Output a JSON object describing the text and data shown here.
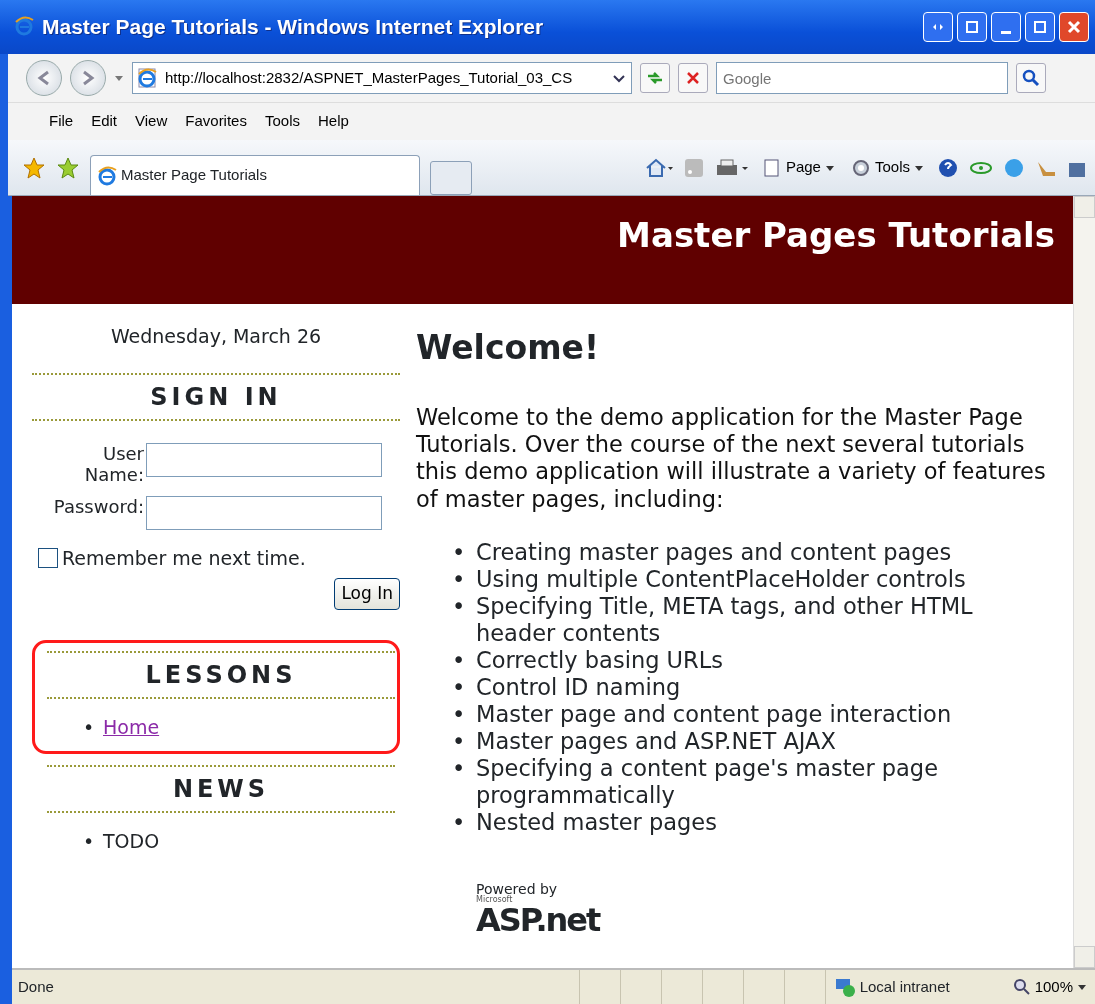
{
  "window": {
    "title": "Master Page Tutorials - Windows Internet Explorer"
  },
  "address_bar": {
    "url": "http://localhost:2832/ASPNET_MasterPages_Tutorial_03_CS"
  },
  "search": {
    "placeholder": "Google"
  },
  "menu": [
    "File",
    "Edit",
    "View",
    "Favorites",
    "Tools",
    "Help"
  ],
  "tabs": [
    {
      "label": "Master Page Tutorials",
      "selected": true
    }
  ],
  "command_bar": [
    "Page",
    "Tools"
  ],
  "page": {
    "header": "Master Pages Tutorials",
    "date": "Wednesday, March 26",
    "sign_in": {
      "heading": "SIGN IN",
      "user_label": "User Name:",
      "password_label": "Password:",
      "remember": {
        "label": "Remember me next time.",
        "checked": false
      },
      "button": "Log In"
    },
    "sections": [
      {
        "heading": "LESSONS",
        "highlighted": true,
        "marker": "•",
        "items": [
          {
            "text": "Home",
            "kind": "link"
          }
        ]
      },
      {
        "heading": "NEWS",
        "highlighted": false,
        "marker": "•",
        "items": [
          {
            "text": "TODO",
            "kind": "text"
          }
        ]
      }
    ],
    "main": {
      "heading": "Welcome!",
      "intro": "Welcome to the demo application for the Master Page Tutorials. Over the course of the next several tutorials this demo application will illustrate a variety of features of master pages, including:",
      "marker": "•",
      "bullets": [
        "Creating master pages and content pages",
        "Using multiple ContentPlaceHolder controls",
        "Specifying Title, META tags, and other HTML header contents",
        "Correctly basing URLs",
        "Control ID naming",
        "Master page and content page interaction",
        "Master pages and ASP.NET AJAX",
        "Specifying a content page's master page programmatically",
        "Nested master pages"
      ]
    },
    "powered": {
      "caption": "Powered by",
      "maker": "Microsoft",
      "logo": "ASP.net"
    }
  },
  "status_bar": {
    "text": "Done",
    "zone": "Local intranet",
    "zoom": "100%"
  }
}
